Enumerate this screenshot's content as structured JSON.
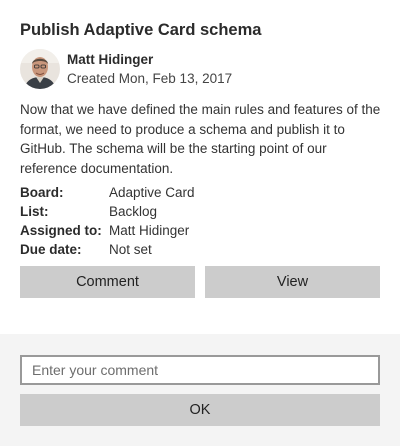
{
  "card": {
    "title": "Publish Adaptive Card schema",
    "author": {
      "name": "Matt Hidinger",
      "created": "Created Mon, Feb 13, 2017",
      "avatar_icon": "person-avatar"
    },
    "description": "Now that we have defined the main rules and features of the format, we need to produce a schema and publish it to GitHub. The schema will be the starting point of our reference documentation.",
    "facts": [
      {
        "title": "Board:",
        "value": "Adaptive Card"
      },
      {
        "title": "List:",
        "value": "Backlog"
      },
      {
        "title": "Assigned to:",
        "value": "Matt Hidinger"
      },
      {
        "title": "Due date:",
        "value": "Not set"
      }
    ],
    "actions": {
      "comment_label": "Comment",
      "view_label": "View"
    }
  },
  "comment_panel": {
    "input_placeholder": "Enter your comment",
    "input_value": "",
    "ok_label": "OK"
  },
  "colors": {
    "button_bg": "#cccccc",
    "panel_bg": "#f4f4f4",
    "input_border": "#999999",
    "text": "#333333"
  }
}
